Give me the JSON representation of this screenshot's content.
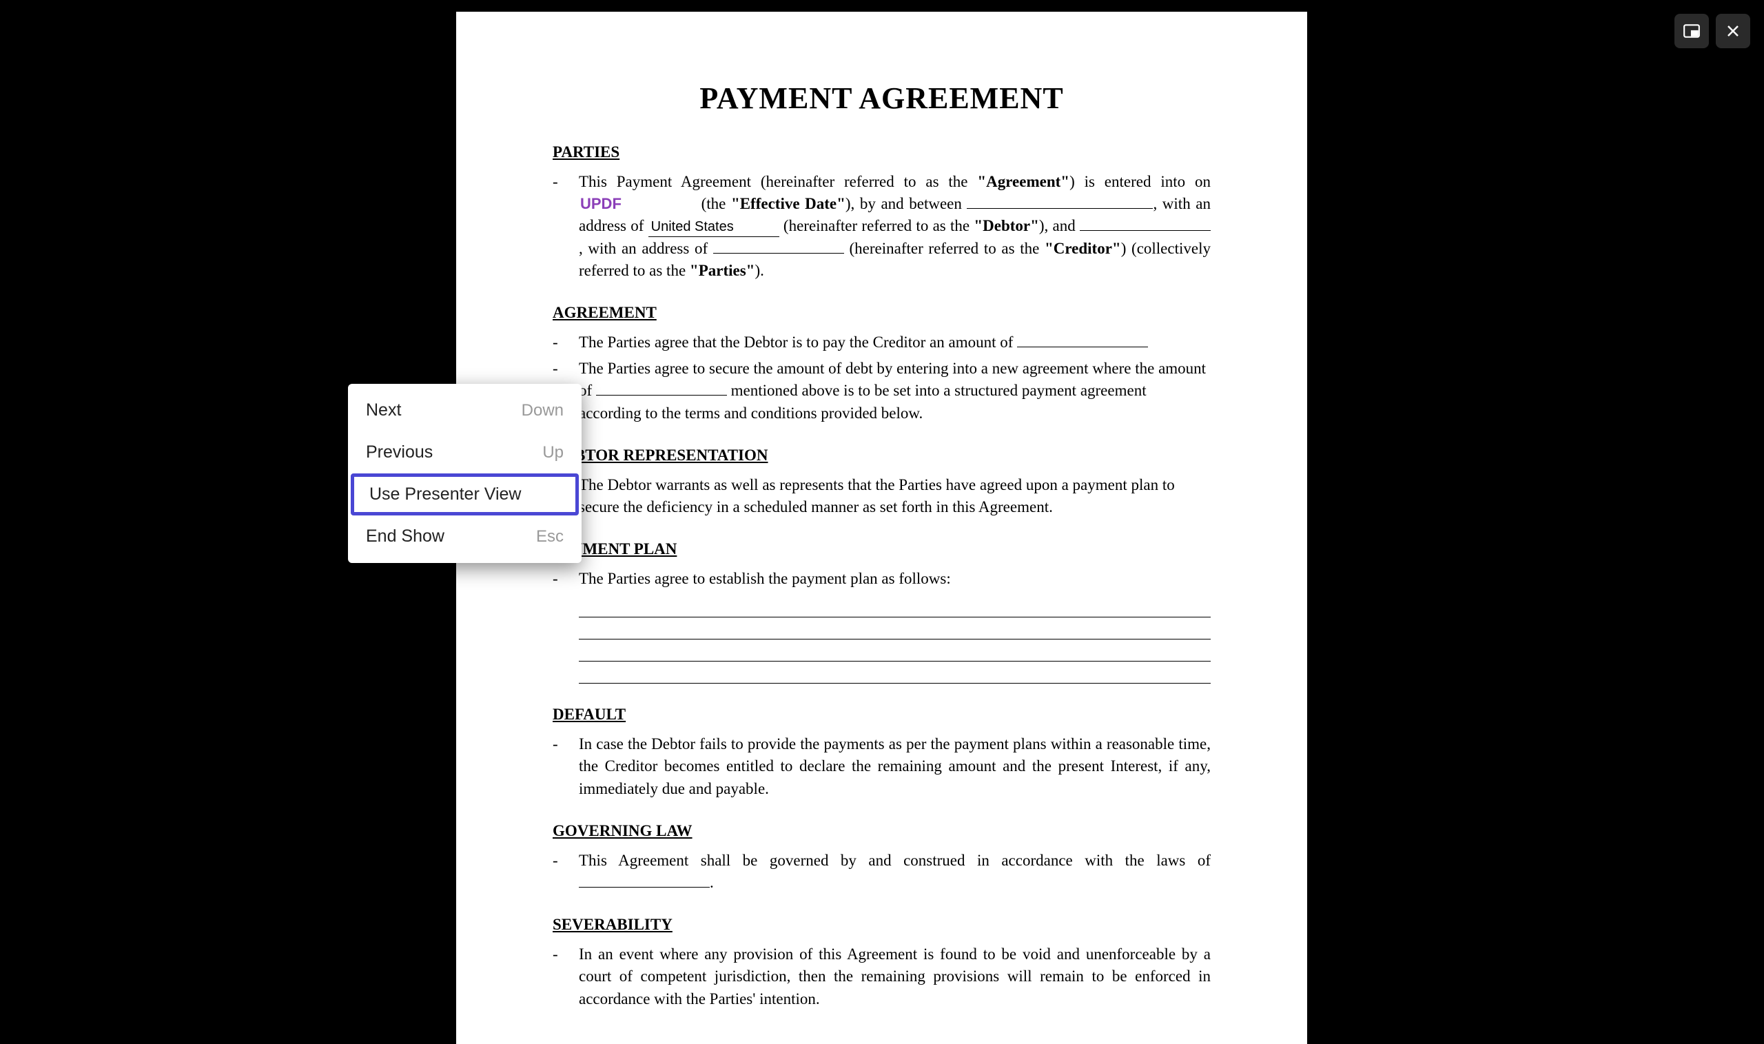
{
  "controls": {
    "pip_label": "picture-in-picture",
    "close_label": "close"
  },
  "context_menu": {
    "items": [
      {
        "label": "Next",
        "shortcut": "Down",
        "highlighted": false
      },
      {
        "label": "Previous",
        "shortcut": "Up",
        "highlighted": false
      },
      {
        "label": "Use Presenter View",
        "shortcut": "",
        "highlighted": true
      },
      {
        "label": "End Show",
        "shortcut": "Esc",
        "highlighted": false
      }
    ]
  },
  "document": {
    "title": "PAYMENT AGREEMENT",
    "sections": {
      "parties": {
        "heading": "PARTIES",
        "text_parts": {
          "p1a": "This Payment Agreement (hereinafter referred to as the ",
          "agreement_bold": "\"Agreement\"",
          "p1b": ") is entered into on ",
          "updf_field": "UPDF",
          "p1c": " (the ",
          "effdate_bold": "\"Effective Date\"",
          "p1d": "), by and between ",
          "p1e": ", with an address of ",
          "us_field": "United States",
          "p1f": " (hereinafter referred to as the ",
          "debtor_bold": "\"Debtor\"",
          "p1g": "), and ",
          "p1h": ", with an address of ",
          "p1i": " (hereinafter referred to as the ",
          "creditor_bold": "\"Creditor\"",
          "p1j": ") (collectively referred to as the ",
          "parties_bold": "\"Parties\"",
          "p1k": ")."
        }
      },
      "agreement": {
        "heading": "AGREEMENT",
        "bullet1": "The Parties agree that the Debtor is to pay the Creditor an amount of ",
        "bullet2a": "The Parties agree to secure the amount of debt by entering into a new agreement where the amount of ",
        "bullet2b": " mentioned above is to be set into a structured payment agreement according to the terms and conditions provided below."
      },
      "debtor_rep": {
        "heading": "DEBTOR REPRESENTATION",
        "bullet1": "The Debtor warrants as well as represents that the Parties have agreed upon a payment plan to secure the deficiency in a scheduled manner as set forth in this Agreement."
      },
      "payment_plan": {
        "heading": "PAYMENT PLAN",
        "bullet1": "The Parties agree to establish the payment plan as follows:"
      },
      "default": {
        "heading": "DEFAULT",
        "bullet1": "In case the Debtor fails to provide the payments as per the payment plans within a reasonable time, the Creditor becomes entitled to declare the remaining amount and the present Interest, if any, immediately due and payable."
      },
      "governing_law": {
        "heading": "GOVERNING LAW",
        "bullet1a": "This Agreement shall be governed by and construed in accordance with the laws of ",
        "bullet1b": "."
      },
      "severability": {
        "heading": "SEVERABILITY",
        "bullet1": "In an event where any provision of this Agreement is found to be void and unenforceable by a court of competent jurisdiction, then the remaining provisions will remain to be enforced in accordance with the Parties' intention."
      }
    }
  }
}
